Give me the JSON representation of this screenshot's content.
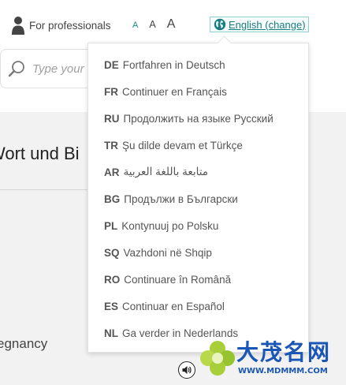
{
  "header": {
    "professionals_label": "For professionals",
    "font_size_labels": [
      "A",
      "A",
      "A"
    ],
    "language_button_label": "English (change)"
  },
  "search": {
    "placeholder": "Type your"
  },
  "content": {
    "heading": "Wort und Bi",
    "subtext": "egnancy"
  },
  "language_menu": {
    "items": [
      {
        "code": "DE",
        "label": "Fortfahren in Deutsch"
      },
      {
        "code": "FR",
        "label": "Continuer en Français"
      },
      {
        "code": "RU",
        "label": "Продолжить на языке Русский"
      },
      {
        "code": "TR",
        "label": "Şu dilde devam et Türkçe"
      },
      {
        "code": "AR",
        "label": "متابعة باللغة العربية"
      },
      {
        "code": "BG",
        "label": "Продължи в Български"
      },
      {
        "code": "PL",
        "label": "Kontynuuj po Polsku"
      },
      {
        "code": "SQ",
        "label": "Vazhdoni në Shqip"
      },
      {
        "code": "RO",
        "label": "Continuare în Română"
      },
      {
        "code": "ES",
        "label": "Continuar en Español"
      },
      {
        "code": "NL",
        "label": "Ga verder in Nederlands"
      }
    ]
  },
  "watermark": {
    "text": "大茂名网",
    "url": "WWW.MDMMM.COM"
  },
  "colors": {
    "accent": "#1a7d80",
    "content_bg": "#f2f2f2",
    "watermark_blue": "#1a56b5"
  },
  "icons": {
    "professionals": "person-icon",
    "language": "globe-icon",
    "search": "search-icon",
    "audio": "speaker-icon"
  }
}
